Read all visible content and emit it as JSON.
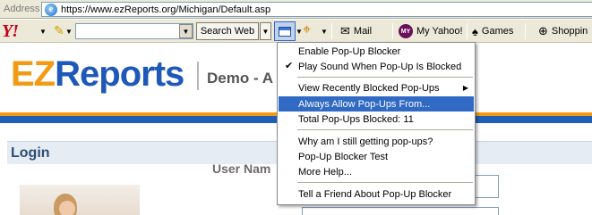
{
  "address_bar": {
    "label": "Address",
    "url": "https://www.ezReports.org/Michigan/Default.asp"
  },
  "toolbar": {
    "yahoo_logo": "Y!",
    "search_value": "",
    "search_button": "Search Web",
    "mail_label": "Mail",
    "my_yahoo_label": "My Yahoo!",
    "my_icon_text": "MY",
    "games_label": "Games",
    "shopping_label": "Shoppin"
  },
  "page": {
    "logo_ez": "EZ",
    "logo_reports": "Reports",
    "demo_text": "Demo - A",
    "login_title": "Login",
    "user_name_label": "User Nam"
  },
  "menu": {
    "items": [
      {
        "label": "Enable Pop-Up Blocker",
        "checked": false
      },
      {
        "label": "Play Sound When Pop-Up Is Blocked",
        "checked": true
      },
      {
        "label": "View Recently Blocked Pop-Ups",
        "submenu": true
      },
      {
        "label": "Always Allow Pop-Ups From...",
        "highlighted": true
      },
      {
        "label": "Total Pop-Ups Blocked: 11"
      },
      {
        "label": "Why am I still getting pop-ups?"
      },
      {
        "label": "Pop-Up Blocker Test"
      },
      {
        "label": "More Help..."
      },
      {
        "label": "Tell a Friend About Pop-Up Blocker"
      }
    ],
    "check_glyph": "✔",
    "submenu_glyph": "▶"
  },
  "colors": {
    "highlight": "#316ac5",
    "logo_orange": "#f39a13",
    "logo_blue": "#1f59b8"
  },
  "icons": {
    "browser": "ie-icon",
    "yahoo": "yahoo-logo",
    "popup_blocker": "popup-window-icon",
    "target": "target-icon",
    "mail": "envelope-icon",
    "games": "games-icon",
    "shopping": "shopping-bag-icon"
  }
}
